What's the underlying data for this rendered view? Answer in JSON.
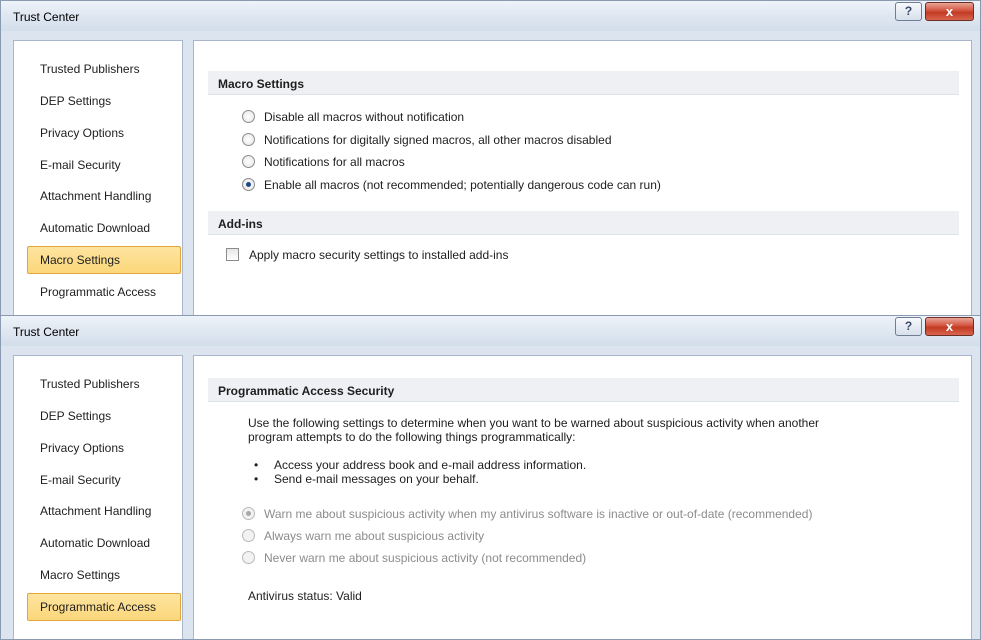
{
  "windows": [
    {
      "title": "Trust Center",
      "help_glyph": "?",
      "close_glyph": "x",
      "sidebar": [
        {
          "label": "Trusted Publishers"
        },
        {
          "label": "DEP Settings"
        },
        {
          "label": "Privacy Options"
        },
        {
          "label": "E-mail Security"
        },
        {
          "label": "Attachment Handling"
        },
        {
          "label": "Automatic Download"
        },
        {
          "label": "Macro Settings",
          "selected": true
        },
        {
          "label": "Programmatic Access"
        }
      ],
      "macro": {
        "header": "Macro Settings",
        "options": [
          {
            "label": "Disable all macros without notification",
            "checked": false
          },
          {
            "label": "Notifications for digitally signed macros, all other macros disabled",
            "checked": false
          },
          {
            "label": "Notifications for all macros",
            "checked": false
          },
          {
            "label": "Enable all macros (not recommended; potentially dangerous code can run)",
            "checked": true
          }
        ]
      },
      "addins": {
        "header": "Add-ins",
        "checkbox_label": "Apply macro security settings to installed add-ins",
        "checked": false
      }
    },
    {
      "title": "Trust Center",
      "help_glyph": "?",
      "close_glyph": "x",
      "sidebar": [
        {
          "label": "Trusted Publishers"
        },
        {
          "label": "DEP Settings"
        },
        {
          "label": "Privacy Options"
        },
        {
          "label": "E-mail Security"
        },
        {
          "label": "Attachment Handling"
        },
        {
          "label": "Automatic Download"
        },
        {
          "label": "Macro Settings"
        },
        {
          "label": "Programmatic Access",
          "selected": true
        }
      ],
      "programmatic": {
        "header": "Programmatic Access Security",
        "description_line1": "Use the following settings to determine when you want to be warned about suspicious activity when another",
        "description_line2": "program attempts to do the following things programmatically:",
        "bullet_char": "•",
        "bullets": [
          "Access your address book and e-mail address information.",
          "Send e-mail messages on your behalf."
        ],
        "options": [
          {
            "label": "Warn me about suspicious activity when my antivirus software is inactive or out-of-date (recommended)",
            "checked": true,
            "disabled": true
          },
          {
            "label": "Always warn me about suspicious activity",
            "checked": false,
            "disabled": true
          },
          {
            "label": "Never warn me about suspicious activity (not recommended)",
            "checked": false,
            "disabled": true
          }
        ],
        "antivirus_label": "Antivirus status:",
        "antivirus_value": "Valid"
      }
    }
  ]
}
